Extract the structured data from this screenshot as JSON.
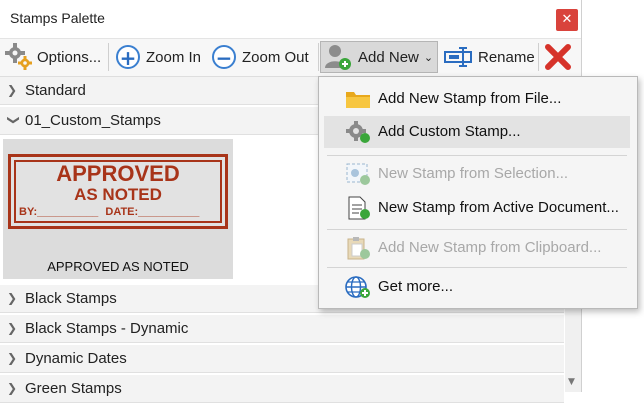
{
  "window": {
    "title": "Stamps Palette",
    "close_glyph": "✕"
  },
  "toolbar": {
    "options_label": "Options...",
    "zoom_in_label": "Zoom In",
    "zoom_out_label": "Zoom Out",
    "add_new_label": "Add New",
    "rename_label": "Rename"
  },
  "categories": {
    "standard": "Standard",
    "custom": "01_Custom_Stamps",
    "black": "Black Stamps",
    "black_dynamic": "Black Stamps - Dynamic",
    "dynamic_dates": "Dynamic Dates",
    "green": "Green Stamps"
  },
  "stamp": {
    "line1": "APPROVED",
    "line2": "AS NOTED",
    "by_label": "BY:__________",
    "date_label": "DATE:__________",
    "caption": "APPROVED AS NOTED",
    "color": "#a83419"
  },
  "menu": {
    "items": [
      {
        "label": "Add New Stamp from File...",
        "icon": "folder-icon"
      },
      {
        "label": "Add Custom Stamp...",
        "icon": "gear-icon"
      },
      {
        "label": "New Stamp from Selection...",
        "icon": "selection-icon"
      },
      {
        "label": "New Stamp from Active Document...",
        "icon": "document-icon"
      },
      {
        "label": "Add New Stamp from Clipboard...",
        "icon": "clipboard-icon"
      },
      {
        "label": "Get more...",
        "icon": "globe-icon"
      }
    ]
  },
  "colors": {
    "accent": "#3a7fd0",
    "close": "#d9433c",
    "delete": "#d6332a"
  }
}
